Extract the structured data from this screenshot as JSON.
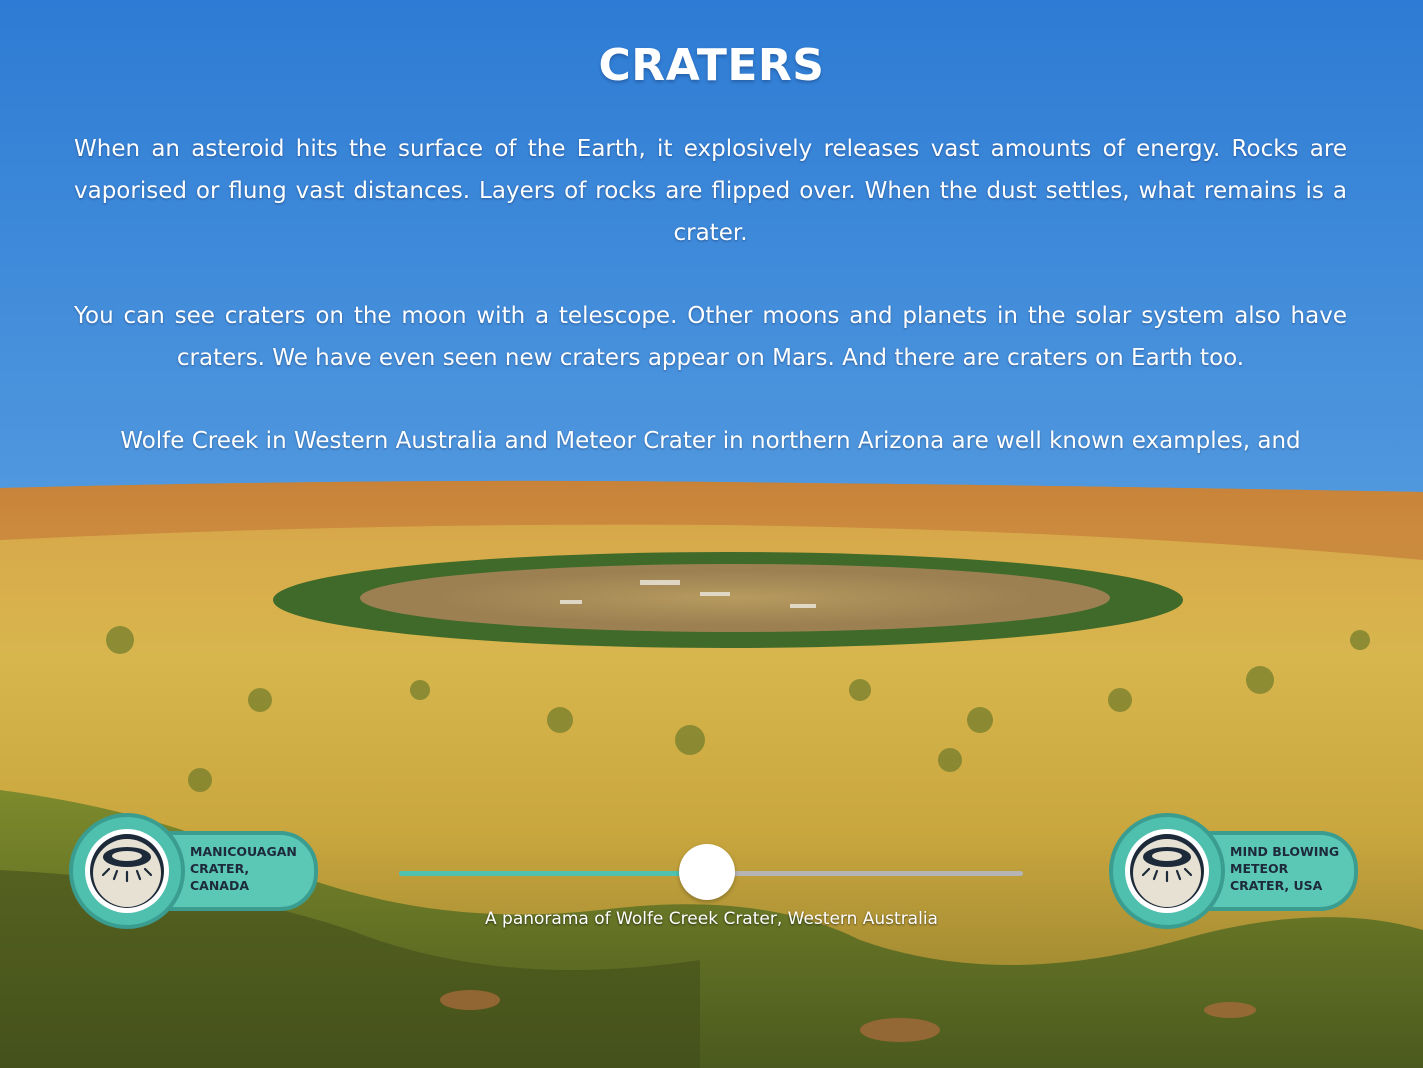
{
  "page": {
    "title": "CRATERS",
    "paragraphs": [
      "When an asteroid hits the surface of the Earth, it explosively releases vast amounts of energy. Rocks are vaporised or flung vast distances. Layers of rocks are flipped over. When the dust settles, what remains is a crater.",
      "You can see craters on the moon with a telescope. Other moons and planets in the solar system also have craters.  We have even seen new craters appear on Mars. And there are craters on Earth too.",
      "Wolfe Creek in Western Australia and Meteor Crater in northern Arizona are well known examples, and"
    ]
  },
  "panorama": {
    "caption": "A panorama of Wolfe Creek Crater, Western Australia",
    "slider_position_percent": 49.4
  },
  "nav": {
    "prev": {
      "label": "MANICOUAGAN\nCRATER,\nCANADA",
      "icon": "crater-icon"
    },
    "next": {
      "label": "MIND BLOWING\nMETEOR\nCRATER, USA",
      "icon": "crater-icon"
    }
  },
  "colors": {
    "sky_top": "#2f7fd6",
    "sky_bottom": "#b8d8ee",
    "accent_teal": "#5bc8b6",
    "accent_teal_dark": "#3a9d90",
    "slider_fill": "#4fc2b0",
    "slider_track": "#b5b5b5"
  }
}
